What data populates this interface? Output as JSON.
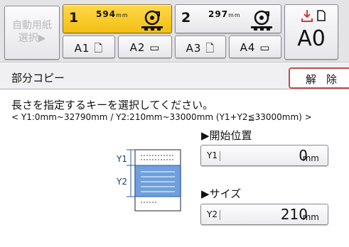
{
  "header": {
    "auto_select": {
      "line1": "自動用紙",
      "line2": "選択▶"
    },
    "rolls": [
      {
        "number": "1",
        "length": "594",
        "unit": "mm"
      },
      {
        "number": "2",
        "length": "297",
        "unit": "mm"
      }
    ],
    "paper_sizes": [
      "A1",
      "A2",
      "A3",
      "A4"
    ],
    "output_size": "A0"
  },
  "panel": {
    "title": "部分コピー",
    "release_label": "解除",
    "instruction": "長さを指定するキーを選択してください。",
    "range": "< Y1:0mm~32790mm / Y2:210mm~33000mm (Y1+Y2≦33000mm) >",
    "start_position": {
      "label": "開始位置",
      "tag": "Y1",
      "value": "0",
      "unit": "mm"
    },
    "size": {
      "label": "サイズ",
      "tag": "Y2",
      "value": "210",
      "unit": "mm"
    },
    "diagram": {
      "y1": "Y1",
      "y2": "Y2"
    }
  },
  "colors": {
    "accent_yellow": "#f2bf12",
    "blue_region": "#6f9fdc",
    "release_border": "#c24e4e"
  }
}
